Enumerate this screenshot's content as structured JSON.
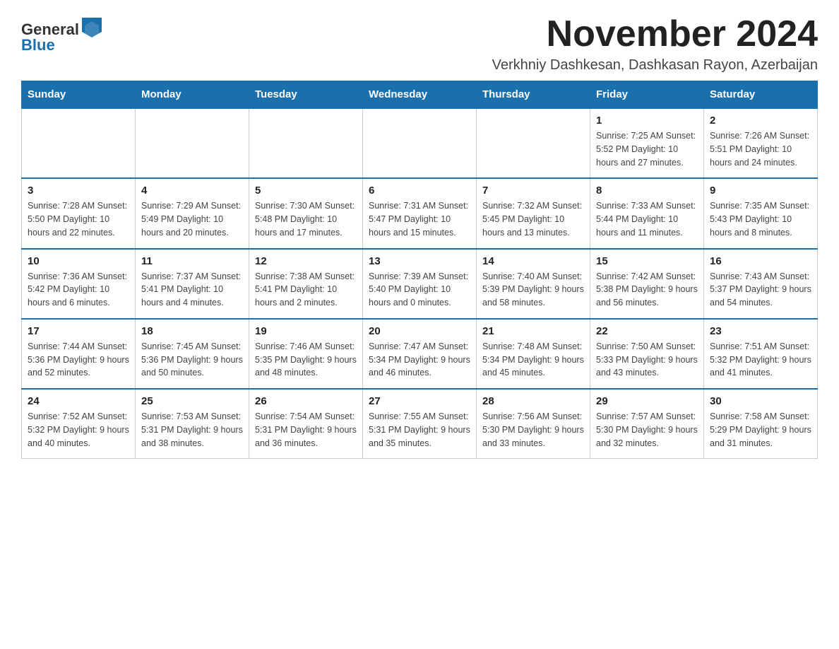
{
  "header": {
    "logo_general": "General",
    "logo_blue": "Blue",
    "title": "November 2024",
    "subtitle": "Verkhniy Dashkesan, Dashkasan Rayon, Azerbaijan"
  },
  "weekdays": [
    "Sunday",
    "Monday",
    "Tuesday",
    "Wednesday",
    "Thursday",
    "Friday",
    "Saturday"
  ],
  "weeks": [
    [
      {
        "day": "",
        "info": ""
      },
      {
        "day": "",
        "info": ""
      },
      {
        "day": "",
        "info": ""
      },
      {
        "day": "",
        "info": ""
      },
      {
        "day": "",
        "info": ""
      },
      {
        "day": "1",
        "info": "Sunrise: 7:25 AM\nSunset: 5:52 PM\nDaylight: 10 hours and 27 minutes."
      },
      {
        "day": "2",
        "info": "Sunrise: 7:26 AM\nSunset: 5:51 PM\nDaylight: 10 hours and 24 minutes."
      }
    ],
    [
      {
        "day": "3",
        "info": "Sunrise: 7:28 AM\nSunset: 5:50 PM\nDaylight: 10 hours and 22 minutes."
      },
      {
        "day": "4",
        "info": "Sunrise: 7:29 AM\nSunset: 5:49 PM\nDaylight: 10 hours and 20 minutes."
      },
      {
        "day": "5",
        "info": "Sunrise: 7:30 AM\nSunset: 5:48 PM\nDaylight: 10 hours and 17 minutes."
      },
      {
        "day": "6",
        "info": "Sunrise: 7:31 AM\nSunset: 5:47 PM\nDaylight: 10 hours and 15 minutes."
      },
      {
        "day": "7",
        "info": "Sunrise: 7:32 AM\nSunset: 5:45 PM\nDaylight: 10 hours and 13 minutes."
      },
      {
        "day": "8",
        "info": "Sunrise: 7:33 AM\nSunset: 5:44 PM\nDaylight: 10 hours and 11 minutes."
      },
      {
        "day": "9",
        "info": "Sunrise: 7:35 AM\nSunset: 5:43 PM\nDaylight: 10 hours and 8 minutes."
      }
    ],
    [
      {
        "day": "10",
        "info": "Sunrise: 7:36 AM\nSunset: 5:42 PM\nDaylight: 10 hours and 6 minutes."
      },
      {
        "day": "11",
        "info": "Sunrise: 7:37 AM\nSunset: 5:41 PM\nDaylight: 10 hours and 4 minutes."
      },
      {
        "day": "12",
        "info": "Sunrise: 7:38 AM\nSunset: 5:41 PM\nDaylight: 10 hours and 2 minutes."
      },
      {
        "day": "13",
        "info": "Sunrise: 7:39 AM\nSunset: 5:40 PM\nDaylight: 10 hours and 0 minutes."
      },
      {
        "day": "14",
        "info": "Sunrise: 7:40 AM\nSunset: 5:39 PM\nDaylight: 9 hours and 58 minutes."
      },
      {
        "day": "15",
        "info": "Sunrise: 7:42 AM\nSunset: 5:38 PM\nDaylight: 9 hours and 56 minutes."
      },
      {
        "day": "16",
        "info": "Sunrise: 7:43 AM\nSunset: 5:37 PM\nDaylight: 9 hours and 54 minutes."
      }
    ],
    [
      {
        "day": "17",
        "info": "Sunrise: 7:44 AM\nSunset: 5:36 PM\nDaylight: 9 hours and 52 minutes."
      },
      {
        "day": "18",
        "info": "Sunrise: 7:45 AM\nSunset: 5:36 PM\nDaylight: 9 hours and 50 minutes."
      },
      {
        "day": "19",
        "info": "Sunrise: 7:46 AM\nSunset: 5:35 PM\nDaylight: 9 hours and 48 minutes."
      },
      {
        "day": "20",
        "info": "Sunrise: 7:47 AM\nSunset: 5:34 PM\nDaylight: 9 hours and 46 minutes."
      },
      {
        "day": "21",
        "info": "Sunrise: 7:48 AM\nSunset: 5:34 PM\nDaylight: 9 hours and 45 minutes."
      },
      {
        "day": "22",
        "info": "Sunrise: 7:50 AM\nSunset: 5:33 PM\nDaylight: 9 hours and 43 minutes."
      },
      {
        "day": "23",
        "info": "Sunrise: 7:51 AM\nSunset: 5:32 PM\nDaylight: 9 hours and 41 minutes."
      }
    ],
    [
      {
        "day": "24",
        "info": "Sunrise: 7:52 AM\nSunset: 5:32 PM\nDaylight: 9 hours and 40 minutes."
      },
      {
        "day": "25",
        "info": "Sunrise: 7:53 AM\nSunset: 5:31 PM\nDaylight: 9 hours and 38 minutes."
      },
      {
        "day": "26",
        "info": "Sunrise: 7:54 AM\nSunset: 5:31 PM\nDaylight: 9 hours and 36 minutes."
      },
      {
        "day": "27",
        "info": "Sunrise: 7:55 AM\nSunset: 5:31 PM\nDaylight: 9 hours and 35 minutes."
      },
      {
        "day": "28",
        "info": "Sunrise: 7:56 AM\nSunset: 5:30 PM\nDaylight: 9 hours and 33 minutes."
      },
      {
        "day": "29",
        "info": "Sunrise: 7:57 AM\nSunset: 5:30 PM\nDaylight: 9 hours and 32 minutes."
      },
      {
        "day": "30",
        "info": "Sunrise: 7:58 AM\nSunset: 5:29 PM\nDaylight: 9 hours and 31 minutes."
      }
    ]
  ]
}
